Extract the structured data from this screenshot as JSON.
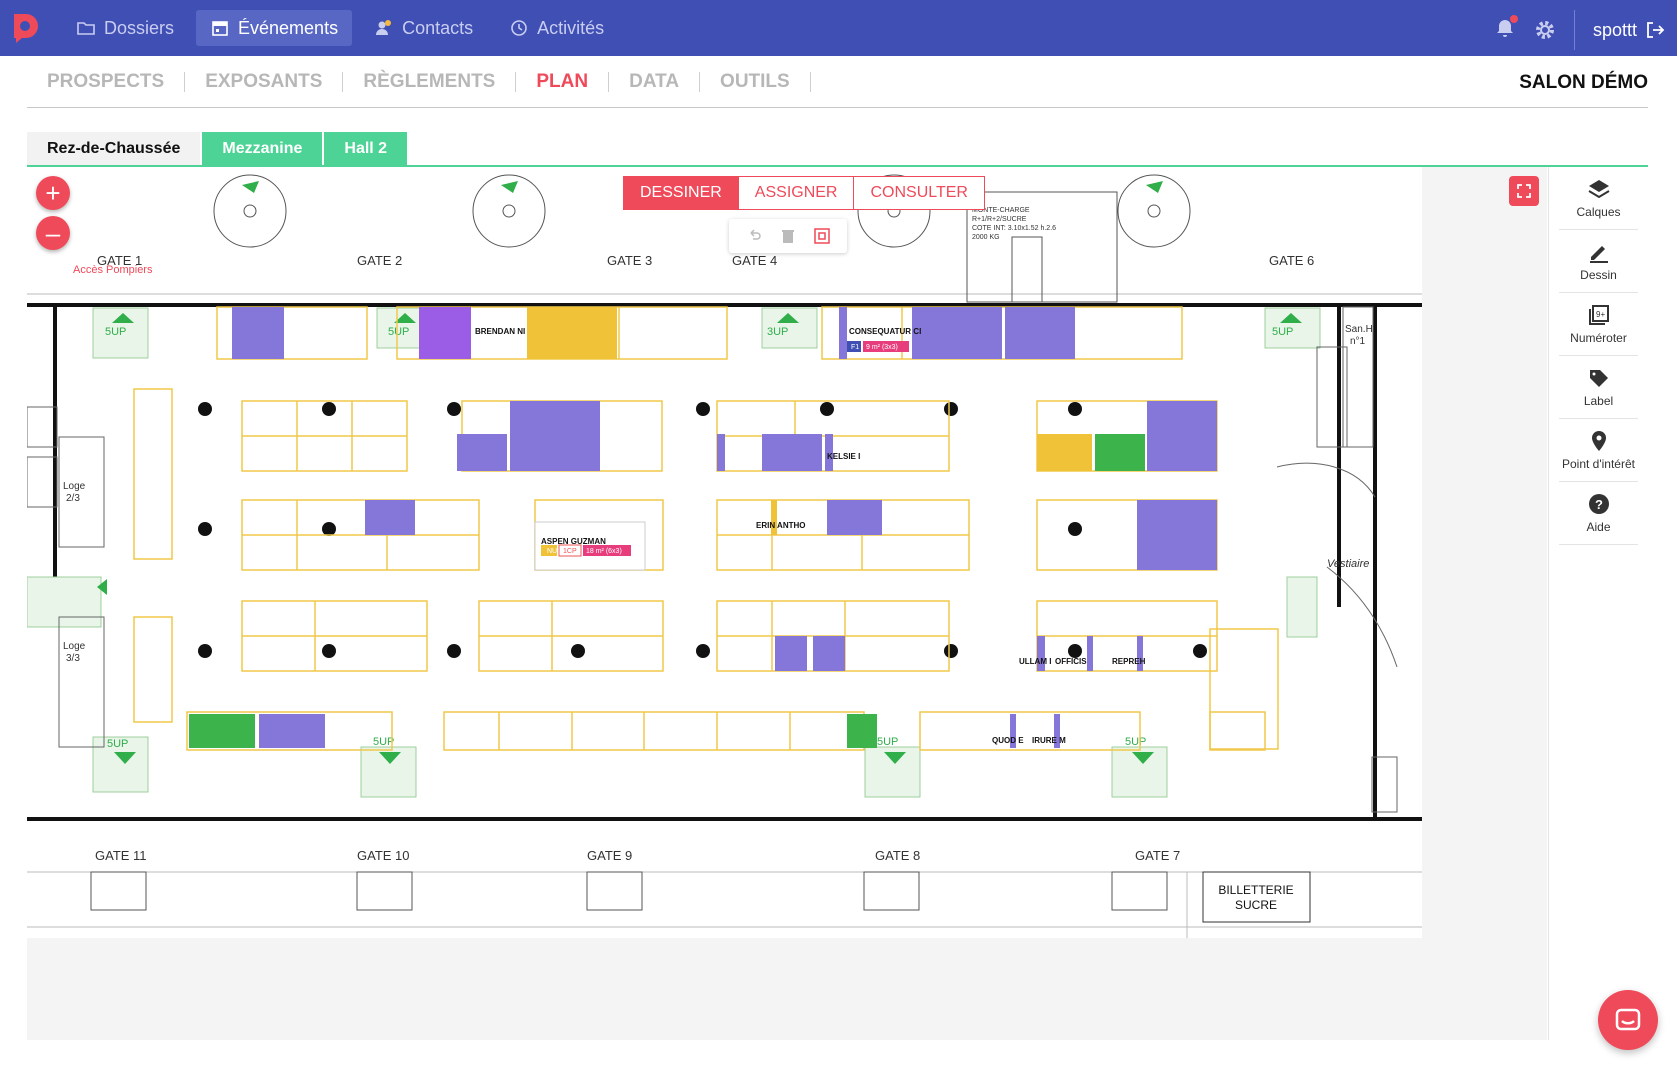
{
  "topbar": {
    "nav": [
      {
        "label": "Dossiers",
        "icon": "folder-icon",
        "active": false
      },
      {
        "label": "Événements",
        "icon": "calendar-icon",
        "active": true
      },
      {
        "label": "Contacts",
        "icon": "contacts-icon",
        "active": false
      },
      {
        "label": "Activités",
        "icon": "history-icon",
        "active": false
      }
    ],
    "user": "spottt"
  },
  "subnav": {
    "tabs": [
      "PROSPECTS",
      "EXPOSANTS",
      "RÈGLEMENTS",
      "PLAN",
      "DATA",
      "OUTILS"
    ],
    "active": "PLAN",
    "salon": "SALON DÉMO"
  },
  "levels": [
    {
      "label": "Rez-de-Chaussée",
      "active": true
    },
    {
      "label": "Mezzanine",
      "active": false
    },
    {
      "label": "Hall 2",
      "active": false
    }
  ],
  "modes": [
    {
      "label": "DESSINER",
      "active": true
    },
    {
      "label": "ASSIGNER",
      "active": false
    },
    {
      "label": "CONSULTER",
      "active": false
    }
  ],
  "sidebar": [
    {
      "label": "Calques",
      "icon": "layers-icon"
    },
    {
      "label": "Dessin",
      "icon": "pencil-icon"
    },
    {
      "label": "Numéroter",
      "icon": "numbering-icon"
    },
    {
      "label": "Label",
      "icon": "tag-icon"
    },
    {
      "label": "Point d'intérêt",
      "icon": "pin-icon"
    },
    {
      "label": "Aide",
      "icon": "help-icon"
    }
  ],
  "plan": {
    "gates_top": [
      "GATE 1",
      "GATE 2",
      "GATE 3",
      "GATE 4",
      "GATE 6"
    ],
    "gates_bottom": [
      "GATE 11",
      "GATE 10",
      "GATE 9",
      "GATE 8",
      "GATE 7"
    ],
    "notes": {
      "acces": "Accès Pompiers",
      "monte_charge": "MONTE-CHARGE R+1/R+2/SUCRE COTE INT: 3.10x1.52 h.2.6 2000 KG",
      "billetterie": "BILLETTERIE SUCRE",
      "vestiaire": "Vestiaire",
      "loge1": "Loge 2/3",
      "loge2": "Loge 3/3",
      "sanit": "San.H n°1"
    },
    "exhibitors": [
      "BRENDAN NI",
      "CONSEQUATUR CI",
      "KELSIE I",
      "ASPEN GUZMAN",
      "ERIN ANTHO",
      "ULLAM I",
      "OFFICIS",
      "REPREH",
      "QUOD E",
      "IRURE M"
    ],
    "booth_tags": {
      "aspen": [
        "NU",
        "1CP",
        "18 m² (6x3)"
      ],
      "consequatur": [
        "F1",
        "9 m² (3x3)"
      ]
    },
    "stairs": [
      "2UP",
      "5UP",
      "3UP"
    ]
  }
}
